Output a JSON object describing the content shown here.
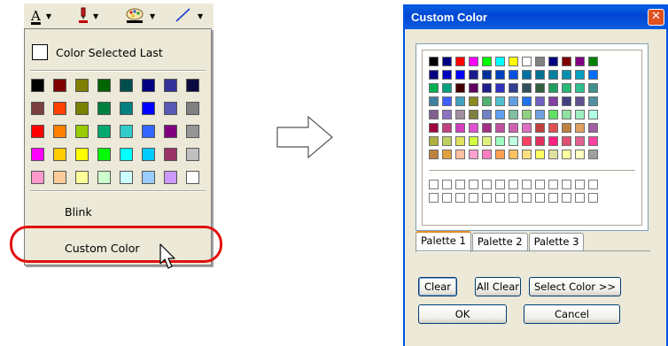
{
  "left_menu": {
    "toolbar": {
      "text_color_glyph": "A",
      "icons": [
        "text-color-icon",
        "pen-color-icon",
        "palette-icon",
        "line-color-icon"
      ]
    },
    "color_selected_last_label": "Color Selected Last",
    "swatch_rows": [
      [
        "#000000",
        "#800000",
        "#808000",
        "#006400",
        "#004d4d",
        "#000080",
        "#333399",
        "#0a0a40"
      ],
      [
        "#7a4040",
        "#ff4000",
        "#7a8000",
        "#008040",
        "#008080",
        "#0000ff",
        "#5a5ab4",
        "#808080"
      ],
      [
        "#ff0000",
        "#ff8000",
        "#99cc00",
        "#00a870",
        "#33cccc",
        "#3366ff",
        "#800080",
        "#969696"
      ],
      [
        "#ff00ff",
        "#ffcc00",
        "#ffff00",
        "#00ff00",
        "#00ffff",
        "#00ccff",
        "#993366",
        "#c0c0c0"
      ],
      [
        "#ff99cc",
        "#ffcc99",
        "#ffff99",
        "#ccffcc",
        "#ccffff",
        "#99ccff",
        "#cc99ff",
        "#ffffff"
      ]
    ],
    "blink_label": "Blink",
    "custom_color_label": "Custom Color"
  },
  "dialog": {
    "title": "Custom Color",
    "close_glyph": "✕",
    "palette_rows": [
      [
        "#000000",
        "#000080",
        "#ff0000",
        "#ff00ff",
        "#00ff00",
        "#00ffff",
        "#ffff00",
        "#ffffff",
        "#808080",
        "#000080",
        "#800000",
        "#800080",
        "#008000",
        "#008080",
        "#808000",
        "#c0c0c0"
      ],
      [
        "#000080",
        "#0000c0",
        "#0000ff",
        "#1a1a8c",
        "#0030a0",
        "#0040c0",
        "#0050e0",
        "#0070a0",
        "#007090",
        "#0080a0",
        "#0090b0",
        "#00a0c0",
        "#0070ff"
      ],
      [
        "#00b050",
        "#00a080",
        "#400000",
        "#600060",
        "#1e1e8c",
        "#3030c0",
        "#304090",
        "#305060",
        "#306040",
        "#20a060",
        "#28b878",
        "#30c090",
        "#409090"
      ],
      [
        "#4080a0",
        "#4060ff",
        "#40a0c0",
        "#8a8a20",
        "#50b070",
        "#50c0d0",
        "#60a0e0",
        "#2070f0",
        "#7060c0",
        "#8040a0",
        "#404080",
        "#605090",
        "#5090a0"
      ],
      [
        "#806090",
        "#9070c0",
        "#a090a0",
        "#808040",
        "#7080c0",
        "#60a0f0",
        "#80c0a0",
        "#90d080",
        "#70a0e0",
        "#60e060",
        "#90e0a0",
        "#a0f0c0",
        "#b0ffe0"
      ],
      [
        "#a00040",
        "#c04080",
        "#d040c0",
        "#e050d0",
        "#a03080",
        "#c050a0",
        "#d060b0",
        "#e070c0",
        "#c04040",
        "#e05050",
        "#c08040",
        "#e0a060",
        "#a060a0"
      ],
      [
        "#b0b040",
        "#c0d060",
        "#e0e060",
        "#d0ff40",
        "#e0f080",
        "#a0ffc0",
        "#c0ffe0",
        "#ff4060",
        "#e03060",
        "#ff2080",
        "#e05070",
        "#e06090",
        "#ff40a0"
      ],
      [
        "#c08040",
        "#e0a040",
        "#ffc0a0",
        "#ffa0d0",
        "#ff80c0",
        "#ffa050",
        "#ffc060",
        "#ffe080",
        "#ffff60",
        "#e0e0a0",
        "#ffffa0",
        "#ffffc0",
        "#a0a0a0"
      ]
    ],
    "empty_rows": 2,
    "empty_cols": 13,
    "tabs": [
      "Palette 1",
      "Palette 2",
      "Palette 3"
    ],
    "active_tab": 0,
    "buttons": {
      "clear": "Clear",
      "all_clear": "All Clear",
      "select_color": "Select Color >>",
      "ok": "OK",
      "cancel": "Cancel"
    }
  }
}
